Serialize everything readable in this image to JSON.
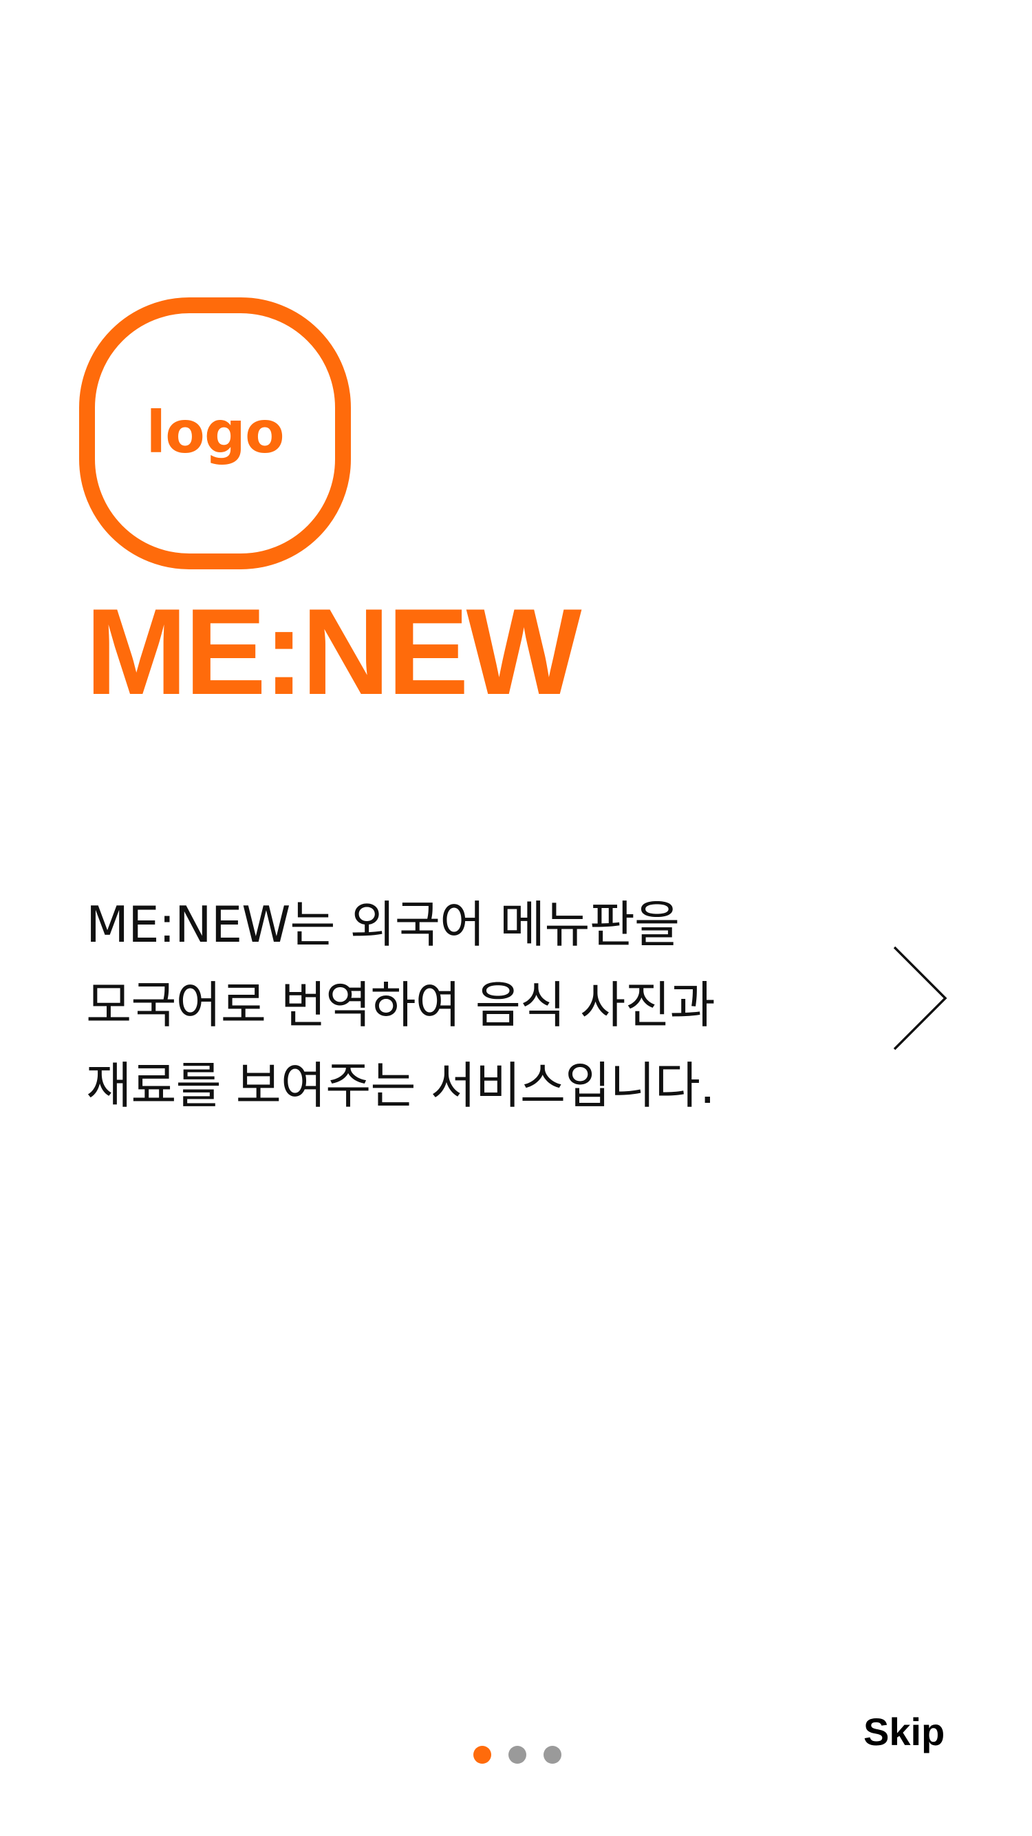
{
  "logo": {
    "text": "logo"
  },
  "app_name": "ME:NEW",
  "description_lines": [
    "ME:NEW는 외국어 메뉴판을",
    "모국어로 번역하여 음식 사진과",
    "재료를 보여주는 서비스입니다."
  ],
  "next_arrow": {
    "icon": "chevron-right-icon"
  },
  "pager": {
    "total": 3,
    "current": 1
  },
  "skip_label": "Skip",
  "colors": {
    "accent": "#ff6b0b",
    "text": "#111111",
    "dot_inactive": "#9a9a9a",
    "background": "#ffffff"
  }
}
